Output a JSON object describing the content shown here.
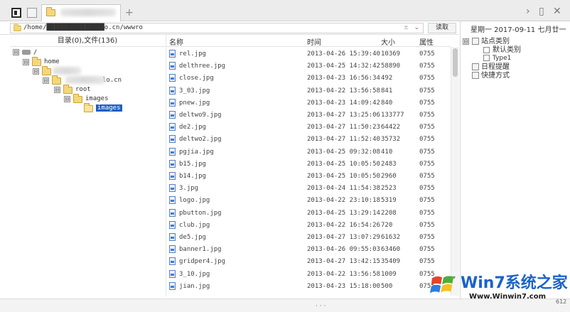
{
  "address": {
    "path": "/home/███████████████o.cn/wwwro",
    "read_button": "读取",
    "clear_icon": "±",
    "dropdown_icon": "chevron-down"
  },
  "tree": {
    "header": "目录(0),文件(136)",
    "nodes": [
      {
        "label": "/",
        "type": "drive",
        "toggle": "⊟"
      },
      {
        "label": "home",
        "type": "folder",
        "toggle": "⊟"
      },
      {
        "label": "",
        "type": "folder",
        "toggle": "⊟"
      },
      {
        "label": "lo.cn",
        "type": "folder",
        "toggle": "⊟"
      },
      {
        "label": "root",
        "type": "folder",
        "toggle": "⊟"
      },
      {
        "label": "images",
        "type": "folder",
        "toggle": "⊟"
      },
      {
        "label": "images",
        "type": "folder-open",
        "toggle": "",
        "selected": true
      }
    ]
  },
  "file_list": {
    "columns": [
      "名称",
      "时间",
      "大小",
      "属性"
    ],
    "rows": [
      {
        "name": "rel.jpg",
        "time": "2013-04-26 15:39:40",
        "size": "10369",
        "attr": "0755"
      },
      {
        "name": "delthree.jpg",
        "time": "2013-04-25 14:32:42",
        "size": "58890",
        "attr": "0755"
      },
      {
        "name": "close.jpg",
        "time": "2013-04-23 16:56:34",
        "size": "492",
        "attr": "0755"
      },
      {
        "name": "3_03.jpg",
        "time": "2013-04-22 13:56:58",
        "size": "841",
        "attr": "0755"
      },
      {
        "name": "pnew.jpg",
        "time": "2013-04-23 14:09:42",
        "size": "840",
        "attr": "0755"
      },
      {
        "name": "deltwo9.jpg",
        "time": "2013-04-27 13:25:06",
        "size": "133777",
        "attr": "0755"
      },
      {
        "name": "de2.jpg",
        "time": "2013-04-27 11:50:23",
        "size": "64422",
        "attr": "0755"
      },
      {
        "name": "deltwo2.jpg",
        "time": "2013-04-27 11:52:40",
        "size": "35732",
        "attr": "0755"
      },
      {
        "name": "pgjia.jpg",
        "time": "2013-04-25 09:32:08",
        "size": "410",
        "attr": "0755"
      },
      {
        "name": "b15.jpg",
        "time": "2013-04-25 10:05:50",
        "size": "2483",
        "attr": "0755"
      },
      {
        "name": "b14.jpg",
        "time": "2013-04-25 10:05:50",
        "size": "2960",
        "attr": "0755"
      },
      {
        "name": "3.jpg",
        "time": "2013-04-24 11:54:38",
        "size": "2523",
        "attr": "0755"
      },
      {
        "name": "logo.jpg",
        "time": "2013-04-22 23:10:18",
        "size": "5319",
        "attr": "0755"
      },
      {
        "name": "pbutton.jpg",
        "time": "2013-04-25 13:29:14",
        "size": "2208",
        "attr": "0755"
      },
      {
        "name": "club.jpg",
        "time": "2013-04-22 16:54:26",
        "size": "720",
        "attr": "0755"
      },
      {
        "name": "de5.jpg",
        "time": "2013-04-27 13:07:29",
        "size": "61632",
        "attr": "0755"
      },
      {
        "name": "banner1.jpg",
        "time": "2013-04-26 09:55:03",
        "size": "63460",
        "attr": "0755"
      },
      {
        "name": "gridper4.jpg",
        "time": "2013-04-27 13:42:15",
        "size": "35409",
        "attr": "0755"
      },
      {
        "name": "3_10.jpg",
        "time": "2013-04-22 13:56:58",
        "size": "1009",
        "attr": "0755"
      },
      {
        "name": "jian.jpg",
        "time": "2013-04-23 15:18:00",
        "size": "500",
        "attr": "0755"
      }
    ]
  },
  "right_panel": {
    "date": "星期一  2017-09-11  七月廿一",
    "items": [
      {
        "label": "站点类别",
        "toggle": "⊟",
        "icon": "category-icon"
      },
      {
        "label": "默认类别",
        "toggle": "",
        "icon": "checkbox"
      },
      {
        "label": "Type1",
        "toggle": "",
        "icon": "checkbox"
      },
      {
        "label": "日程提醒",
        "toggle": "",
        "icon": "schedule-icon"
      },
      {
        "label": "快捷方式",
        "toggle": "",
        "icon": "shortcut-icon"
      }
    ]
  },
  "bottom": {
    "status": "· · ·",
    "corner": "612"
  },
  "watermark": {
    "brand": "Win7系统之家",
    "url": "Www.Winwin7.com"
  },
  "colors": {
    "selection": "#1e5fc4",
    "folder": "#f5d67b",
    "brand": "#1a63c9"
  }
}
